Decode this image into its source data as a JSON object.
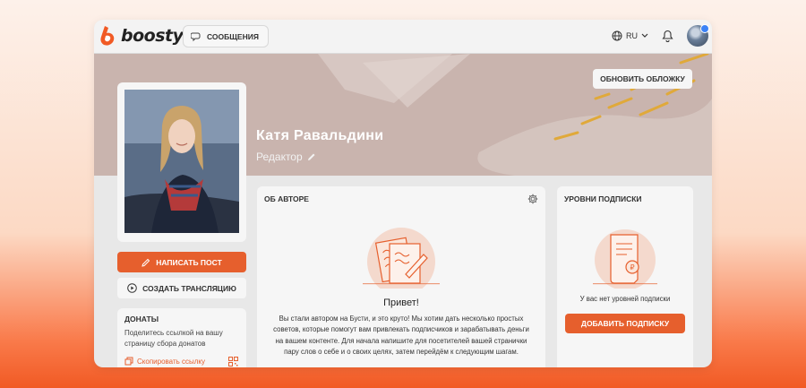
{
  "colors": {
    "accent": "#e65f2d",
    "cover": "#c8b6b0",
    "gold": "#e0a93a"
  },
  "header": {
    "logo_text": "boosty",
    "messages_label": "СООБЩЕНИЯ",
    "language": "RU"
  },
  "cover": {
    "update_cover_label": "ОБНОВИТЬ ОБЛОЖКУ",
    "name": "Катя Равальдини",
    "role": "Редактор"
  },
  "sidebar": {
    "write_post_label": "НАПИСАТЬ ПОСТ",
    "stream_label": "СОЗДАТЬ ТРАНСЛЯЦИЮ",
    "donats": {
      "title": "ДОНАТЫ",
      "text": "Поделитесь ссылкой на вашу страницу сбора донатов",
      "copy_link": "Скопировать ссылку"
    }
  },
  "about": {
    "title": "ОБ АВТОРЕ",
    "hello": "Привет!",
    "text": "Вы стали автором на Бусти, и это круто! Мы хотим дать несколько простых советов, которые помогут вам привлекать подписчиков и зарабатывать деньги на вашем контенте. Для начала напишите для посетителей вашей странички пару слов о себе и о своих целях, затем перейдём к следующим шагам."
  },
  "subscriptions": {
    "title": "УРОВНИ ПОДПИСКИ",
    "empty_text": "У вас нет уровней подписки",
    "add_label": "ДОБАВИТЬ ПОДПИСКУ"
  }
}
